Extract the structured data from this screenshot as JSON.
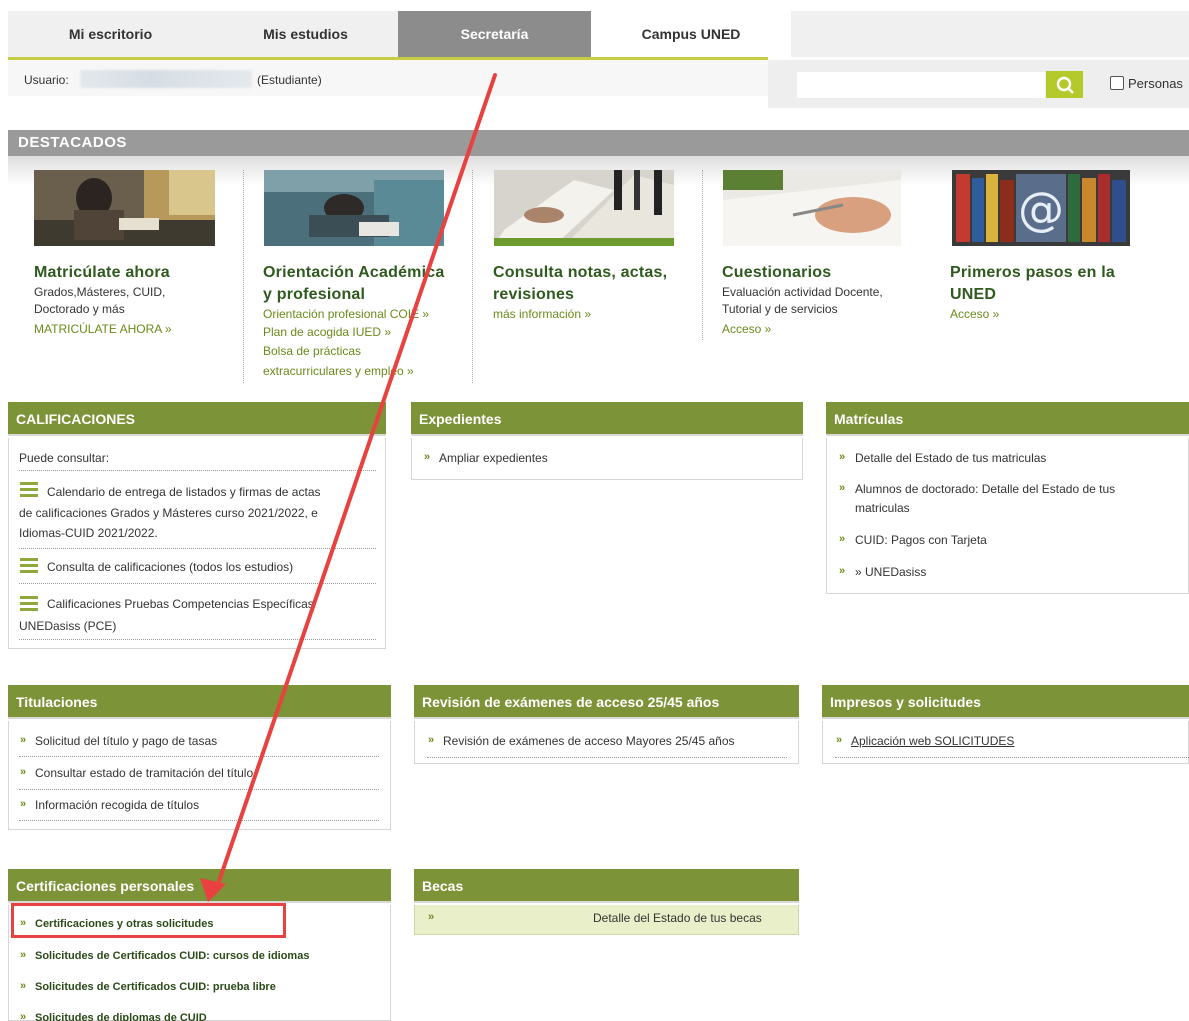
{
  "nav": {
    "tabs": [
      {
        "label": "Mi escritorio"
      },
      {
        "label": "Mis estudios"
      },
      {
        "label": "Secretaría"
      },
      {
        "label": "Campus UNED"
      }
    ]
  },
  "user": {
    "label": "Usuario:",
    "role": "(Estudiante)"
  },
  "search": {
    "placeholder": "",
    "checkbox_label": "Personas"
  },
  "destacados": {
    "title": "DESTACADOS",
    "items": [
      {
        "title": [
          "Matricúlate ahora"
        ],
        "sub": [
          "Grados,Másteres, CUID,",
          "Doctorado y más"
        ],
        "links": [
          "MATRICÚLATE AHORA »"
        ]
      },
      {
        "title": [
          "Orientación Académica",
          "y profesional"
        ],
        "sub": [],
        "links": [
          "Orientación profesional COIE »",
          "Plan de acogida IUED »",
          "Bolsa de prácticas",
          "extracurriculares y empleo »"
        ]
      },
      {
        "title": [
          "Consulta notas, actas,",
          "revisiones"
        ],
        "sub": [],
        "links": [
          "más información »"
        ]
      },
      {
        "title": [
          "Cuestionarios"
        ],
        "sub": [
          "Evaluación actividad Docente,",
          "Tutorial y de servicios"
        ],
        "links": [
          "Acceso »"
        ]
      },
      {
        "title": [
          "Primeros pasos en la",
          "UNED"
        ],
        "sub": [],
        "links": [
          "Acceso »"
        ]
      }
    ]
  },
  "calificaciones": {
    "title": "CALIFICACIONES",
    "intro": "Puede consultar:",
    "items": [
      [
        "Calendario de entrega de listados y firmas de actas",
        "de calificaciones Grados y Másteres curso 2021/2022, e",
        "Idiomas-CUID 2021/2022."
      ],
      [
        "Consulta de calificaciones (todos los estudios)"
      ],
      [
        "Calificaciones Pruebas Competencias Específicas",
        "UNEDasiss (PCE)"
      ]
    ]
  },
  "expedientes": {
    "title": "Expedientes",
    "items": [
      "Ampliar expedientes"
    ]
  },
  "matriculas": {
    "title": "Matrículas",
    "items": [
      [
        "Detalle del Estado de tus matriculas"
      ],
      [
        "Alumnos de doctorado: Detalle del Estado de tus",
        "matriculas"
      ],
      [
        "CUID: Pagos con Tarjeta"
      ],
      [
        "» UNEDasiss"
      ]
    ]
  },
  "titulaciones": {
    "title": "Titulaciones",
    "items": [
      "Solicitud del título y pago de tasas",
      "Consultar estado de tramitación del título",
      "Información recogida de títulos"
    ]
  },
  "revision": {
    "title": "Revisión de exámenes de acceso 25/45 años",
    "items": [
      "Revisión de exámenes de acceso Mayores 25/45 años"
    ]
  },
  "impresos": {
    "title": "Impresos y solicitudes",
    "items": [
      "Aplicación web SOLICITUDES"
    ]
  },
  "certificaciones": {
    "title": "Certificaciones personales",
    "items": [
      "Certificaciones y otras solicitudes",
      "Solicitudes de Certificados CUID: cursos de idiomas",
      "Solicitudes de Certificados CUID: prueba libre",
      "Solicitudes de diplomas de CUID"
    ]
  },
  "becas": {
    "title": "Becas",
    "items": [
      "Detalle del Estado de tus becas"
    ]
  },
  "colors": {
    "accent": "#7c9338",
    "highlight": "#e8413f",
    "lime": "#b6c92a"
  }
}
